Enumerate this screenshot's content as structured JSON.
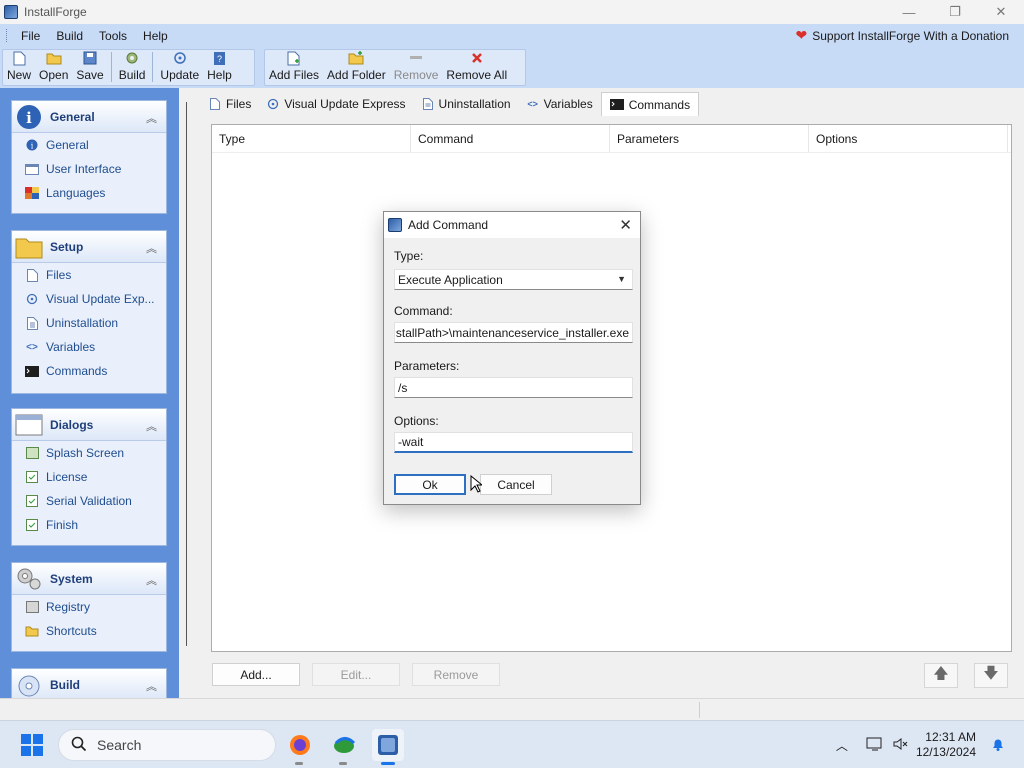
{
  "window": {
    "title": "InstallForge",
    "controls": [
      "—",
      "❐",
      "✕"
    ]
  },
  "menu": {
    "items": [
      "File",
      "Build",
      "Tools",
      "Help"
    ],
    "donate": "Support InstallForge With a Donation"
  },
  "toolbar": {
    "new": "New",
    "open": "Open",
    "save": "Save",
    "build": "Build",
    "update": "Update",
    "help": "Help",
    "add_files": "Add Files",
    "add_folder": "Add Folder",
    "remove": "Remove",
    "remove_all": "Remove All"
  },
  "sidebar": {
    "general": {
      "title": "General",
      "items": [
        "General",
        "User Interface",
        "Languages"
      ]
    },
    "setup": {
      "title": "Setup",
      "items": [
        "Files",
        "Visual Update Exp...",
        "Uninstallation",
        "Variables",
        "Commands"
      ]
    },
    "dialogs": {
      "title": "Dialogs",
      "items": [
        "Splash Screen",
        "License",
        "Serial Validation",
        "Finish"
      ]
    },
    "system": {
      "title": "System",
      "items": [
        "Registry",
        "Shortcuts"
      ]
    },
    "build": {
      "title": "Build"
    }
  },
  "tabs": [
    "Files",
    "Visual Update Express",
    "Uninstallation",
    "Variables",
    "Commands"
  ],
  "active_tab": "Commands",
  "list": {
    "columns": [
      "Type",
      "Command",
      "Parameters",
      "Options"
    ]
  },
  "buttons": {
    "add": "Add...",
    "edit": "Edit...",
    "remove": "Remove"
  },
  "dialog": {
    "title": "Add Command",
    "type_label": "Type:",
    "type_value": "Execute Application",
    "command_label": "Command:",
    "command_value": "stallPath>\\maintenanceservice_installer.exe",
    "parameters_label": "Parameters:",
    "parameters_value": "/s",
    "options_label": "Options:",
    "options_value": "-wait",
    "ok": "Ok",
    "cancel": "Cancel"
  },
  "taskbar": {
    "search_placeholder": "Search",
    "time": "12:31 AM",
    "date": "12/13/2024"
  },
  "colors": {
    "accent": "#2d6fc1",
    "sidebar": "#5f8fd8",
    "menubar": "#c7daf6"
  }
}
